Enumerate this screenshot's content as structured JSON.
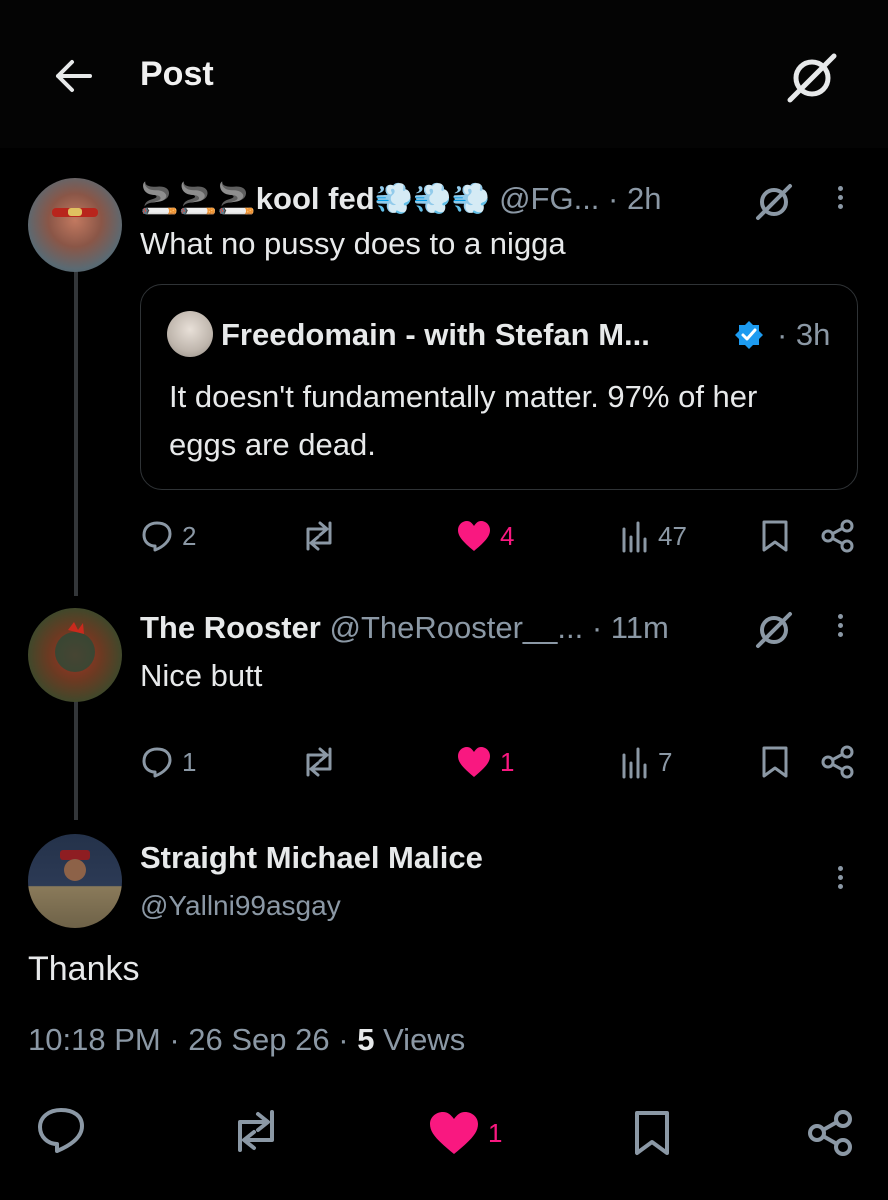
{
  "header": {
    "title": "Post"
  },
  "replies": [
    {
      "display_name": "🚬🚬🚬kool fed💨💨💨",
      "handle": "@FG...",
      "time": "· 2h",
      "text": "What no pussy does to a nigga",
      "quote": {
        "display_name": "Freedomain - with Stefan M...",
        "time": "· 3h",
        "text": "It doesn't fundamentally matter. 97% of her eggs are dead.",
        "verified": true
      },
      "stats": {
        "replies": "2",
        "likes": "4",
        "views": "47"
      }
    },
    {
      "display_name": "The Rooster",
      "handle": "@TheRooster__...",
      "time": "· 11m",
      "text": "Nice butt",
      "stats": {
        "replies": "1",
        "likes": "1",
        "views": "7"
      }
    }
  ],
  "main_post": {
    "display_name": "Straight Michael Malice",
    "handle": "@Yallni99asgay",
    "text": "Thanks",
    "time": "10:18 PM",
    "date": "26 Sep 26",
    "views_count": "5",
    "views_label": "Views",
    "likes": "1"
  },
  "colors": {
    "background": "#000000",
    "text": "#e7e9ea",
    "muted": "#8b98a5",
    "like": "#f91880",
    "verified": "#1d9bf0",
    "border": "#2f3336"
  },
  "icons": [
    "back-arrow-icon",
    "grok-icon",
    "more-icon",
    "reply-icon",
    "repost-icon",
    "heart-icon",
    "views-icon",
    "bookmark-icon",
    "share-icon",
    "verified-badge-icon"
  ]
}
